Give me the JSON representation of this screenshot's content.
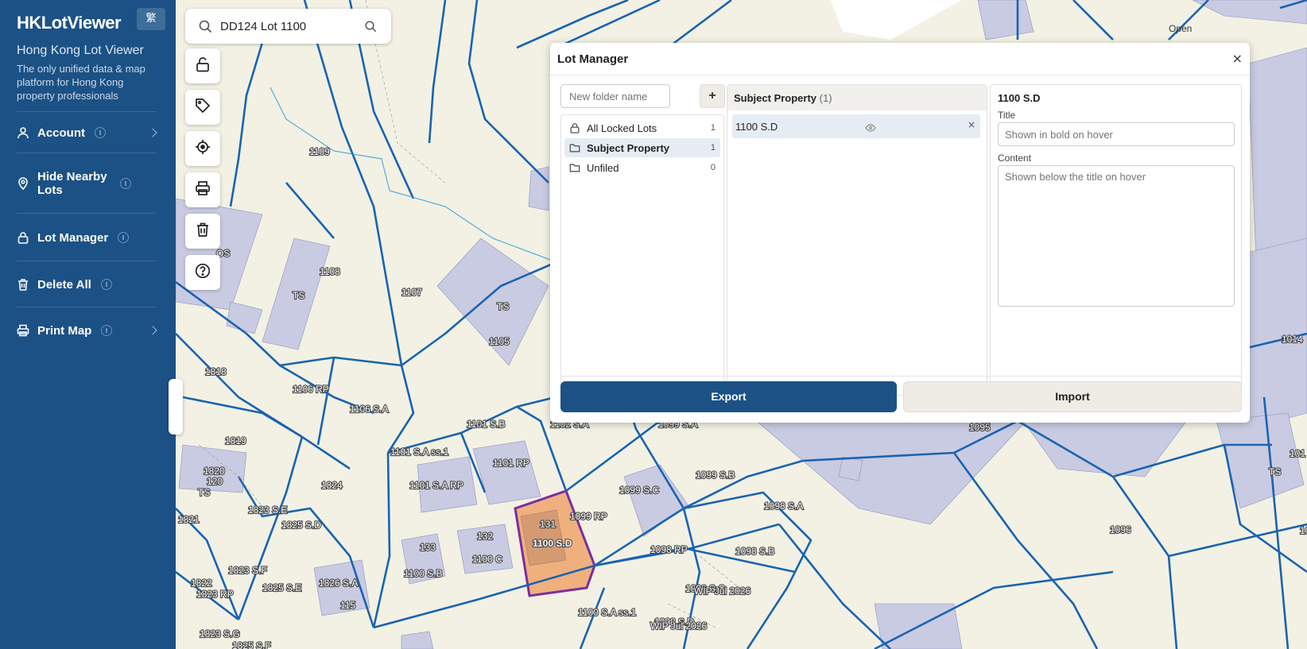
{
  "sidebar": {
    "brand": "HKLotViewer",
    "lang_button": "繁",
    "title": "Hong Kong Lot Viewer",
    "description": "The only unified data & map platform for Hong Kong property professionals",
    "menu": [
      {
        "label": "Account",
        "icon": "user-icon",
        "has_chevron": true
      },
      {
        "label": "Hide Nearby Lots",
        "icon": "location-pin-icon",
        "has_chevron": false
      },
      {
        "label": "Lot Manager",
        "icon": "lock-icon",
        "has_chevron": false
      },
      {
        "label": "Delete All",
        "icon": "trash-icon",
        "has_chevron": false
      },
      {
        "label": "Print Map",
        "icon": "printer-icon",
        "has_chevron": true
      }
    ]
  },
  "search": {
    "value": "DD124 Lot 1100",
    "placeholder": ""
  },
  "toolbar": {
    "icons": [
      "unlock-icon",
      "tag-icon",
      "crosshair-icon",
      "printer-icon",
      "trash-icon",
      "help-icon"
    ]
  },
  "lot_manager": {
    "title": "Lot Manager",
    "close": "×",
    "new_folder_placeholder": "New folder name",
    "add_button": "+",
    "folders": [
      {
        "name": "All Locked Lots",
        "count": "1",
        "icon": "lock-icon",
        "selected": false
      },
      {
        "name": "Subject Property",
        "count": "1",
        "icon": "folder-icon",
        "selected": true
      },
      {
        "name": "Unfiled",
        "count": "0",
        "icon": "folder-icon",
        "selected": false
      }
    ],
    "selected_folder": {
      "name": "Subject Property",
      "count": "(1)"
    },
    "lots": [
      {
        "name": "1100 S.D",
        "remove": "×"
      }
    ],
    "details": {
      "lot_name": "1100 S.D",
      "title_label": "Title",
      "title_placeholder": "Shown in bold on hover",
      "content_label": "Content",
      "content_placeholder": "Shown below the title on hover"
    },
    "export_label": "Export",
    "import_label": "Import"
  },
  "map": {
    "colors": {
      "background": "#f2f1e4",
      "lot_line": "#1a63b0",
      "building": "#c9cbe3",
      "highlight_fill": "#f0b07e",
      "highlight_stroke": "#7a2ea0"
    },
    "labels": [
      {
        "text": "Open",
        "dark": true
      },
      {
        "text": "1109"
      },
      {
        "text": "1108"
      },
      {
        "text": "1107"
      },
      {
        "text": "1105"
      },
      {
        "text": "TS"
      },
      {
        "text": "TS"
      },
      {
        "text": "OS"
      },
      {
        "text": "1818"
      },
      {
        "text": "1106 RP"
      },
      {
        "text": "1106 S.A"
      },
      {
        "text": "1819"
      },
      {
        "text": "1820"
      },
      {
        "text": "120"
      },
      {
        "text": "TS"
      },
      {
        "text": "1101 S.B"
      },
      {
        "text": "1102 S.A"
      },
      {
        "text": "1099 S.A"
      },
      {
        "text": "1101 S.A ss.1"
      },
      {
        "text": "1101 RP"
      },
      {
        "text": "1101 S.A RP"
      },
      {
        "text": "1824"
      },
      {
        "text": "1821"
      },
      {
        "text": "1823 S.E"
      },
      {
        "text": "1825 S.D"
      },
      {
        "text": "1099 S.C"
      },
      {
        "text": "1099 S.B"
      },
      {
        "text": "1098 S.A"
      },
      {
        "text": "1099 RP"
      },
      {
        "text": "131"
      },
      {
        "text": "1100 S.D"
      },
      {
        "text": "132"
      },
      {
        "text": "133"
      },
      {
        "text": "1100 C"
      },
      {
        "text": "1100 S.B"
      },
      {
        "text": "1098 RP"
      },
      {
        "text": "1098 S.B"
      },
      {
        "text": "1823 S.F"
      },
      {
        "text": "1822"
      },
      {
        "text": "1823 RP"
      },
      {
        "text": "1825 S.E"
      },
      {
        "text": "1826 S.A"
      },
      {
        "text": "115"
      },
      {
        "text": "1098 S.C"
      },
      {
        "text": "WIP Jul 2026"
      },
      {
        "text": "1100 S.A ss.1"
      },
      {
        "text": "1098 S.D"
      },
      {
        "text": "WIP Jul 2026"
      },
      {
        "text": "1823 S.G"
      },
      {
        "text": "1825 S.F"
      },
      {
        "text": "1095"
      },
      {
        "text": "1096"
      },
      {
        "text": "1014"
      },
      {
        "text": "101"
      },
      {
        "text": "TS"
      },
      {
        "text": "10"
      }
    ]
  }
}
